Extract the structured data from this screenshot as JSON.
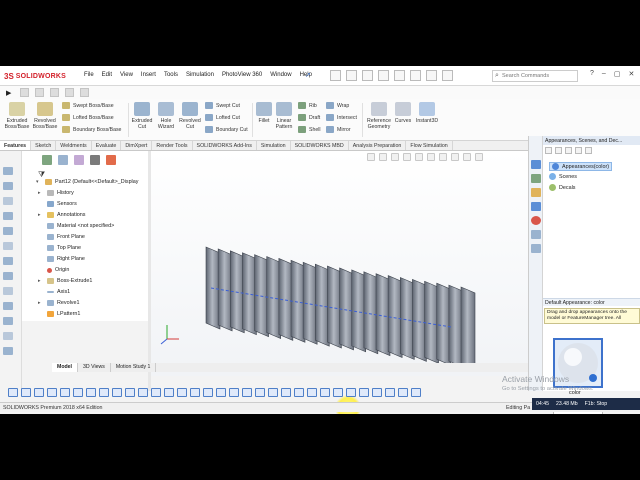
{
  "app": {
    "brand": "SOLIDWORKS",
    "logo_mark": "3S"
  },
  "menu": {
    "items": [
      "File",
      "Edit",
      "View",
      "Insert",
      "Tools",
      "Simulation",
      "PhotoView 360",
      "Window",
      "Help"
    ]
  },
  "search": {
    "placeholder": "Search Commands"
  },
  "ribbon": {
    "extruded_boss": "Extruded Boss/Base",
    "revolved_boss": "Revolved Boss/Base",
    "swept_boss": "Swept Boss/Base",
    "lofted_boss": "Lofted Boss/Base",
    "boundary_boss": "Boundary Boss/Base",
    "extruded_cut": "Extruded Cut",
    "hole_wizard": "Hole Wizard",
    "revolved_cut": "Revolved Cut",
    "swept_cut": "Swept Cut",
    "lofted_cut": "Lofted Cut",
    "boundary_cut": "Boundary Cut",
    "fillet": "Fillet",
    "linear_pattern": "Linear Pattern",
    "rib": "Rib",
    "draft": "Draft",
    "shell": "Shell",
    "wrap": "Wrap",
    "intersect": "Intersect",
    "mirror": "Mirror",
    "reference_geometry": "Reference Geometry",
    "curves": "Curves",
    "instant3d": "Instant3D"
  },
  "cm_tabs": [
    "Features",
    "Sketch",
    "Weldments",
    "Evaluate",
    "DimXpert",
    "Render Tools",
    "SOLIDWORKS Add-Ins",
    "Simulation",
    "SOLIDWORKS MBD",
    "Analysis Preparation",
    "Flow Simulation"
  ],
  "tree": {
    "part": "Part12  (Default<<Default>_Display",
    "items": [
      "History",
      "Sensors",
      "Annotations",
      "Material <not specified>",
      "Front Plane",
      "Top Plane",
      "Right Plane",
      "Origin",
      "Boss-Extrude1",
      "Axis1",
      "Revolve1",
      "LPattern1"
    ]
  },
  "model_tabs": [
    "Model",
    "3D Views",
    "Motion Study 1"
  ],
  "taskpane": {
    "header": "Appearances, Scenes, and Dec...",
    "items": [
      "Appearances(color)",
      "Scenes",
      "Decals"
    ],
    "default_label": "Default Appearance: color",
    "info": "Drag and drop appearances onto the model or FeatureManager tree. All",
    "swatch_label": "color",
    "colors": {
      "swatch": "#2f6fd1",
      "highlight": "#cde2fa"
    }
  },
  "status": {
    "left": "SOLIDWORKS Premium 2018 x64 Edition",
    "right": "Editing Pa"
  },
  "taskbar": {
    "time": "04:45",
    "size": "23.48 Mb",
    "extra": "F1b: Stop"
  },
  "watermark": {
    "title": "Activate Windows",
    "subtitle": "Go to Settings to activate Windows."
  }
}
